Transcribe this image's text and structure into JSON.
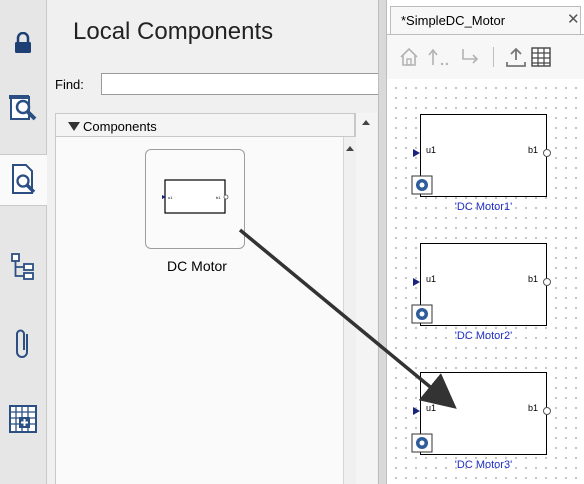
{
  "panel": {
    "title": "Local Components",
    "find_label": "Find:",
    "find_value": "",
    "components_header": "Components",
    "component_card_label": "DC Motor"
  },
  "tool_strip": {
    "icons": [
      "lock-icon",
      "library-browser-icon",
      "local-components-icon",
      "model-tree-icon",
      "attachments-icon",
      "grid-table-icon"
    ]
  },
  "editor": {
    "tab_label": "*SimpleDC_Motor",
    "tab_close": "✕",
    "toolbar_icons": [
      "home-icon",
      "up-arrow-icon",
      "jump-icon",
      "upload-icon",
      "table-icon"
    ],
    "blocks": [
      {
        "in_port": "u1",
        "out_port": "b1",
        "name": "'DC Motor1'"
      },
      {
        "in_port": "u1",
        "out_port": "b1",
        "name": "'DC Motor2'"
      },
      {
        "in_port": "u1",
        "out_port": "b1",
        "name": "'DC Motor3'"
      }
    ]
  },
  "colors": {
    "block_name": "#1f2fc7",
    "port_in": "#1a237e",
    "clear_button": "#2f5d9b"
  }
}
